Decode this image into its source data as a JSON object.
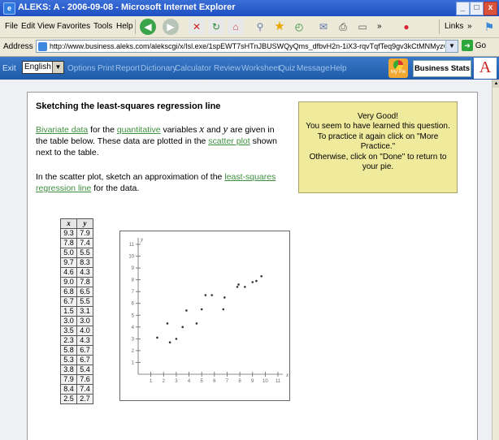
{
  "window": {
    "title": "ALEKS: A - 2006-09-08 - Microsoft Internet Explorer",
    "minimize": "_",
    "maximize": "□",
    "close": "x"
  },
  "menu": {
    "items": [
      "File",
      "Edit",
      "View",
      "Favorites",
      "Tools",
      "Help"
    ],
    "more": "»",
    "links": "Links"
  },
  "address": {
    "label": "Address",
    "url": "http://www.business.aleks.com/alekscgi/x/Isl.exe/1spEWT7sHTnJBUSWQyQms_dfbvH2n-1iX3-rqvTqfTeq9gv3kCtMNMyzCZ3z5SxQ-K3C2cQeGUuZ",
    "go": "Go"
  },
  "toolbar": {
    "exit": "Exit",
    "language": "English",
    "links": [
      "Options",
      "Print",
      "Report",
      "Dictionary",
      "Calculator",
      "Review",
      "Worksheet",
      "Quiz",
      "Message",
      "Help"
    ],
    "my_pie": "My Pie",
    "course": "Business Stats",
    "logo": "A"
  },
  "problem": {
    "title": "Sketching the least-squares regression line",
    "para1": {
      "link1": "Bivariate data",
      "t1": " for the ",
      "link2": "quantitative",
      "t2": " variables ",
      "x": "x",
      "t3": " and ",
      "y": "y",
      "t4": " are given in the table below. These data are plotted in the ",
      "link3": "scatter plot",
      "t5": " shown next to the table."
    },
    "para2": {
      "t1": "In the scatter plot, sketch an approximation of the ",
      "link1": "least-squares regression line",
      "t2": " for the data."
    }
  },
  "message": {
    "line1": "Very Good!",
    "line2": "You seem to have learned this question.",
    "line3": "To practice it again click on \"More Practice.\"",
    "line4": "Otherwise, click on \"Done\" to return to your pie."
  },
  "table": {
    "headers": [
      "x",
      "y"
    ],
    "rows": [
      [
        "9.3",
        "7.9"
      ],
      [
        "7.8",
        "7.4"
      ],
      [
        "5.0",
        "5.5"
      ],
      [
        "9.7",
        "8.3"
      ],
      [
        "4.6",
        "4.3"
      ],
      [
        "9.0",
        "7.8"
      ],
      [
        "6.8",
        "6.5"
      ],
      [
        "6.7",
        "5.5"
      ],
      [
        "1.5",
        "3.1"
      ],
      [
        "3.0",
        "3.0"
      ],
      [
        "3.5",
        "4.0"
      ],
      [
        "2.3",
        "4.3"
      ],
      [
        "5.8",
        "6.7"
      ],
      [
        "5.3",
        "6.7"
      ],
      [
        "3.8",
        "5.4"
      ],
      [
        "7.9",
        "7.6"
      ],
      [
        "8.4",
        "7.4"
      ],
      [
        "2.5",
        "2.7"
      ]
    ]
  },
  "chart_data": {
    "type": "scatter",
    "xlabel": "x",
    "ylabel": "y",
    "xlim": [
      0,
      11
    ],
    "ylim": [
      0,
      11
    ],
    "xticks": [
      "1",
      "2",
      "3",
      "4",
      "5",
      "6",
      "7",
      "8",
      "9",
      "10",
      "11"
    ],
    "yticks": [
      "1",
      "2",
      "3",
      "4",
      "5",
      "6",
      "7",
      "8",
      "9",
      "10",
      "11"
    ],
    "points": [
      [
        9.3,
        7.9
      ],
      [
        7.8,
        7.4
      ],
      [
        5.0,
        5.5
      ],
      [
        9.7,
        8.3
      ],
      [
        4.6,
        4.3
      ],
      [
        9.0,
        7.8
      ],
      [
        6.8,
        6.5
      ],
      [
        6.7,
        5.5
      ],
      [
        1.5,
        3.1
      ],
      [
        3.0,
        3.0
      ],
      [
        3.5,
        4.0
      ],
      [
        2.3,
        4.3
      ],
      [
        5.8,
        6.7
      ],
      [
        5.3,
        6.7
      ],
      [
        3.8,
        5.4
      ],
      [
        7.9,
        7.6
      ],
      [
        8.4,
        7.4
      ],
      [
        2.5,
        2.7
      ]
    ]
  }
}
